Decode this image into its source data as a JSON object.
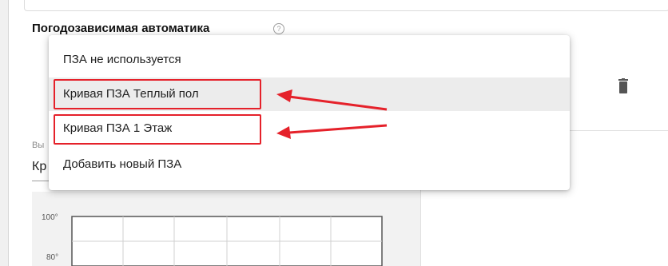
{
  "section": {
    "title": "Погодозависимая автоматика",
    "help_icon": "?"
  },
  "dropdown": {
    "options": [
      {
        "label": "ПЗА не используется"
      },
      {
        "label": "Кривая ПЗА Теплый пол",
        "highlighted": true
      },
      {
        "label": "Кривая ПЗА 1 Этаж",
        "highlighted": true
      },
      {
        "label": "Добавить новый ПЗА"
      }
    ]
  },
  "select": {
    "label": "Вы",
    "value": "Кр"
  },
  "chart": {
    "y_ticks": [
      "100°",
      "80°"
    ]
  },
  "icons": {
    "delete": "trash-icon",
    "help": "question-circle-icon"
  },
  "colors": {
    "highlight": "#e5212a",
    "active_option_bg": "#ececec"
  }
}
